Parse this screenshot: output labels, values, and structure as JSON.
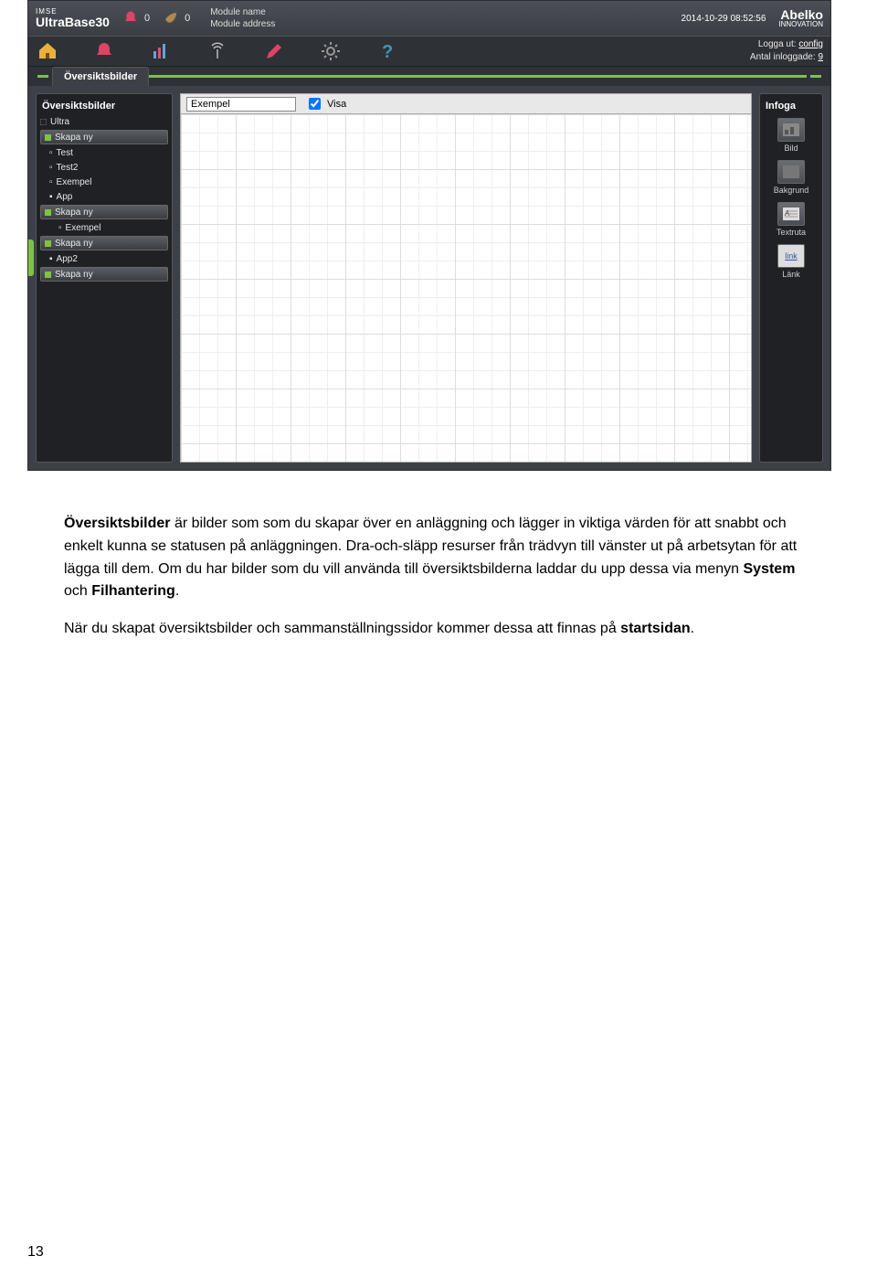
{
  "topbar": {
    "imse": "IMSE",
    "product": "UltraBase30",
    "zero1": "0",
    "zero2": "0",
    "module_name_lbl": "Module name",
    "module_addr_lbl": "Module address",
    "timestamp": "2014-10-29 08:52:56",
    "logo_main": "Abelko",
    "logo_sub": "INNOVATION"
  },
  "acct": {
    "logout_prefix": "Logga ut: ",
    "logout_user": "config",
    "logged_prefix": "Antal inloggade: ",
    "logged_count": "9"
  },
  "tab": {
    "label": "Översiktsbilder"
  },
  "tree": {
    "heading": "Översiktsbilder",
    "root": "Ultra",
    "create": "Skapa ny",
    "items": [
      {
        "label": "Test",
        "kind": "node",
        "indent": 1
      },
      {
        "label": "Test2",
        "kind": "node",
        "indent": 1
      },
      {
        "label": "Exempel",
        "kind": "node",
        "indent": 1
      },
      {
        "label": "App",
        "kind": "folder",
        "indent": 1
      },
      {
        "label": "Skapa ny",
        "kind": "btn",
        "indent": 2
      },
      {
        "label": "Exempel",
        "kind": "node",
        "indent": 2
      },
      {
        "label": "Skapa ny",
        "kind": "btn",
        "indent": 3
      },
      {
        "label": "App2",
        "kind": "folder",
        "indent": 1
      },
      {
        "label": "Skapa ny",
        "kind": "btn",
        "indent": 2
      }
    ]
  },
  "canvas": {
    "name_value": "Exempel",
    "visa_label": "Visa"
  },
  "palette": {
    "heading": "Infoga",
    "items": [
      "Bild",
      "Bakgrund",
      "Textruta",
      "Länk"
    ],
    "link_sample": "link"
  },
  "doc": {
    "p1a": "Översiktsbilder",
    "p1b": " är bilder som som du skapar över en anläggning och lägger in viktiga värden för att snabbt och enkelt kunna se statusen på anläggningen. Dra-och-släpp resurser från trädvyn till vänster ut på arbetsytan för att lägga till dem. Om du har bilder som du vill använda till översiktsbilderna laddar du upp dessa via menyn ",
    "p1c": "System",
    "p1d": " och ",
    "p1e": "Filhantering",
    "p1f": ".",
    "p2a": "När du skapat översiktsbilder och sammanställningssidor kommer dessa att finnas på ",
    "p2b": "startsidan",
    "p2c": "."
  },
  "page_number": "13"
}
